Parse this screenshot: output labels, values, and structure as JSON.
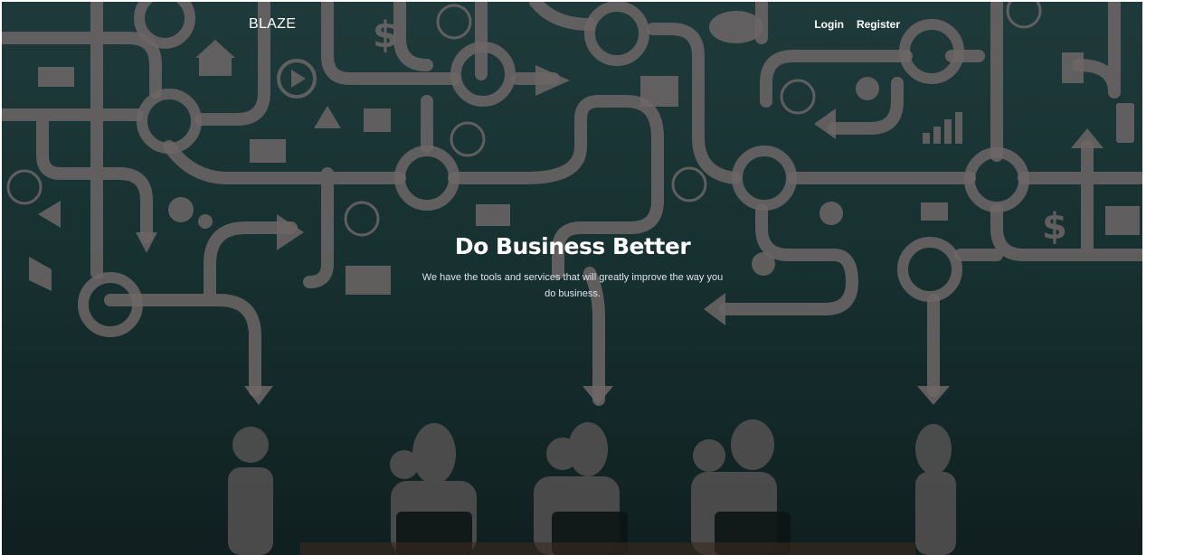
{
  "navbar": {
    "brand": "BLAZE",
    "links": [
      {
        "label": "Login"
      },
      {
        "label": "Register"
      }
    ]
  },
  "hero": {
    "title": "Do Business Better",
    "subtitle": "We have the tools and services that will greatly improve the way you do business."
  },
  "colors": {
    "background_top": "#1f3a3a",
    "background_bottom": "#101f1f",
    "illustration": "#6d6666",
    "text": "#ffffff"
  }
}
